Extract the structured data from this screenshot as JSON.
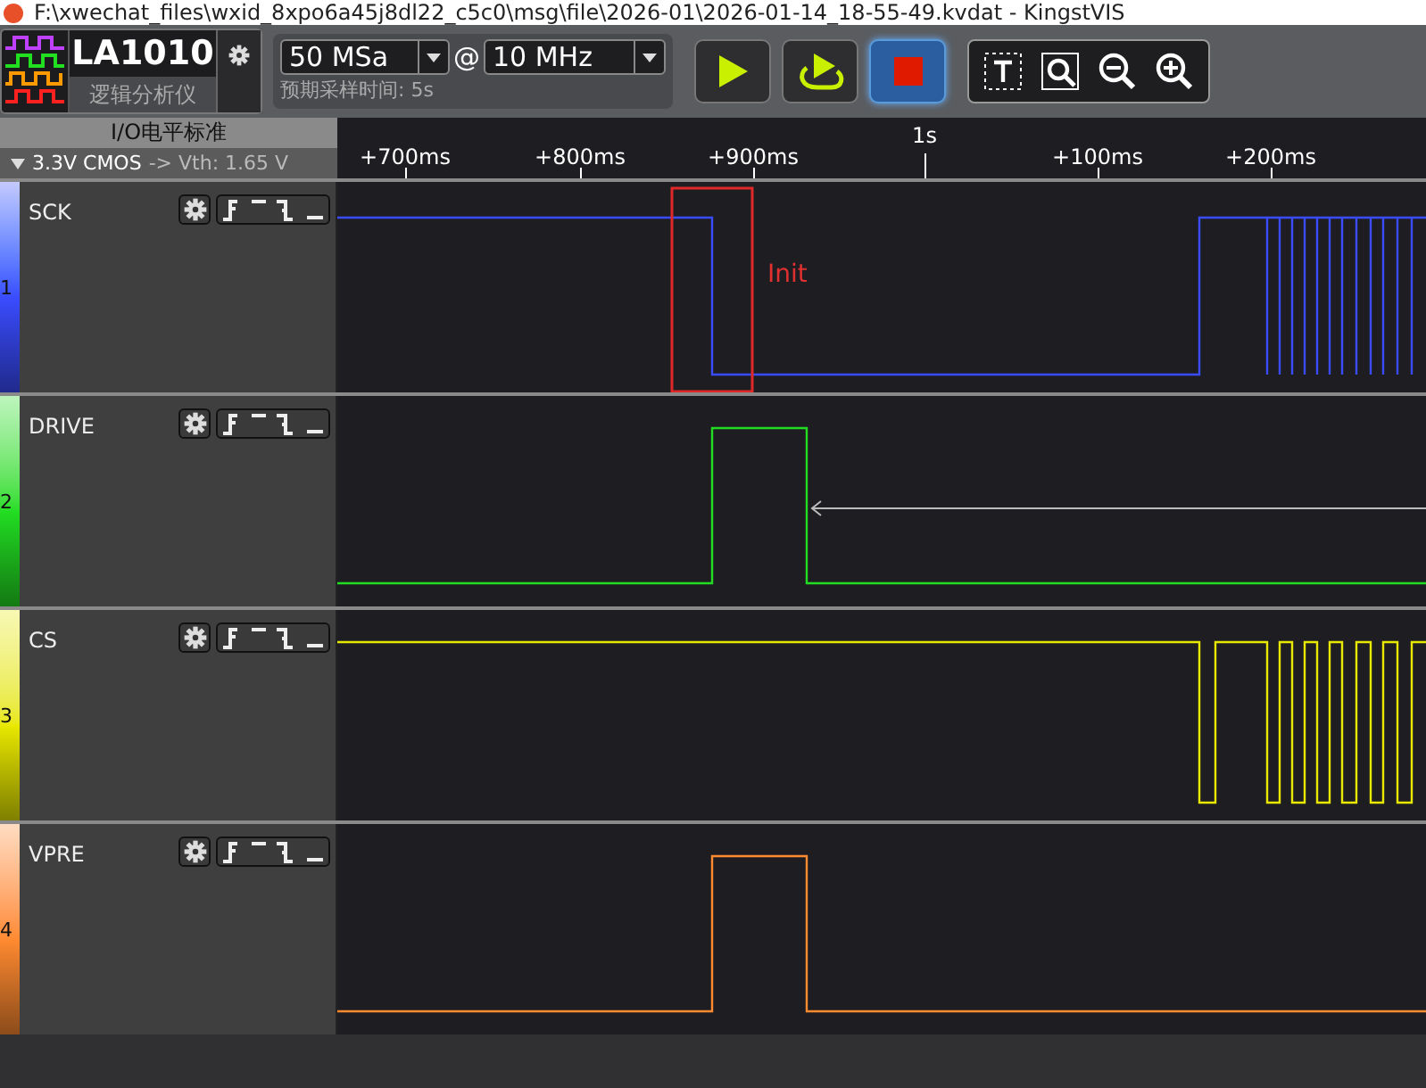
{
  "window": {
    "title": "F:\\xwechat_files\\wxid_8xpo6a45j8dl22_c5c0\\msg\\file\\2026-01\\2026-01-14_18-55-49.kvdat - KingstVIS"
  },
  "device": {
    "model": "LA1010",
    "subtitle": "逻辑分析仪"
  },
  "sample_depth": {
    "value": "50 MSa"
  },
  "separator": "@",
  "sample_rate": {
    "value": "10 MHz"
  },
  "sample_time": "预期采样时间: 5s",
  "run_buttons": [
    {
      "kind": "start",
      "selected": false
    },
    {
      "kind": "loop",
      "selected": false
    },
    {
      "kind": "stop",
      "selected": true
    }
  ],
  "tools": [
    {
      "kind": "text"
    },
    {
      "kind": "zoom-fit"
    },
    {
      "kind": "zoom-out"
    },
    {
      "kind": "zoom-in"
    }
  ],
  "io_standard": {
    "title": "I/O电平标准",
    "value": "3.3V CMOS",
    "threshold": "-> Vth: 1.65 V"
  },
  "ruler": {
    "ticks": [
      {
        "label": "+700ms",
        "major": false
      },
      {
        "label": "+800ms",
        "major": false
      },
      {
        "label": "+900ms",
        "major": false
      },
      {
        "label": "1s",
        "major": true
      },
      {
        "label": "+100ms",
        "major": false
      },
      {
        "label": "+200ms",
        "major": false
      }
    ]
  },
  "channels": [
    {
      "number": "1",
      "name": "SCK",
      "color": "#3a4cff"
    },
    {
      "number": "2",
      "name": "DRIVE",
      "color": "#22dd22"
    },
    {
      "number": "3",
      "name": "CS",
      "color": "#e8e800"
    },
    {
      "number": "4",
      "name": "VPRE",
      "color": "#ff8a30"
    }
  ],
  "annotation": {
    "label": "Init"
  }
}
